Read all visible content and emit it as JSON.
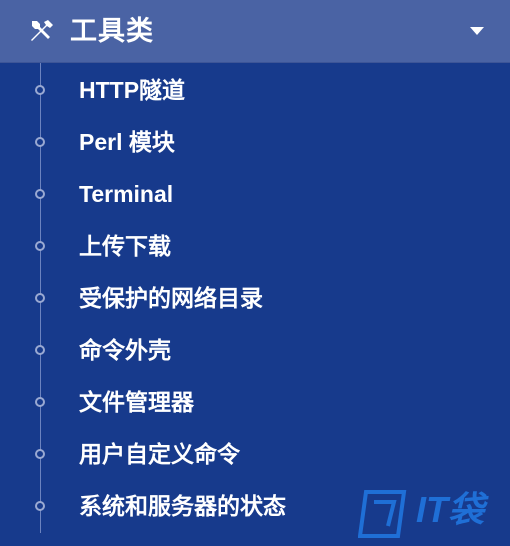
{
  "menu": {
    "title": "工具类",
    "title_icon": "tools-icon",
    "expand_icon": "caret-down-icon",
    "items": [
      {
        "label": "HTTP隧道"
      },
      {
        "label": "Perl 模块"
      },
      {
        "label": "Terminal"
      },
      {
        "label": "上传下载"
      },
      {
        "label": "受保护的网络目录"
      },
      {
        "label": "命令外壳"
      },
      {
        "label": "文件管理器"
      },
      {
        "label": "用户自定义命令"
      },
      {
        "label": "系统和服务器的状态"
      }
    ]
  },
  "watermark": {
    "text": "IT袋"
  },
  "colors": {
    "background": "#173a8c",
    "header": "#4a63a4",
    "text": "#ffffff",
    "watermark": "#1f6fd6"
  }
}
